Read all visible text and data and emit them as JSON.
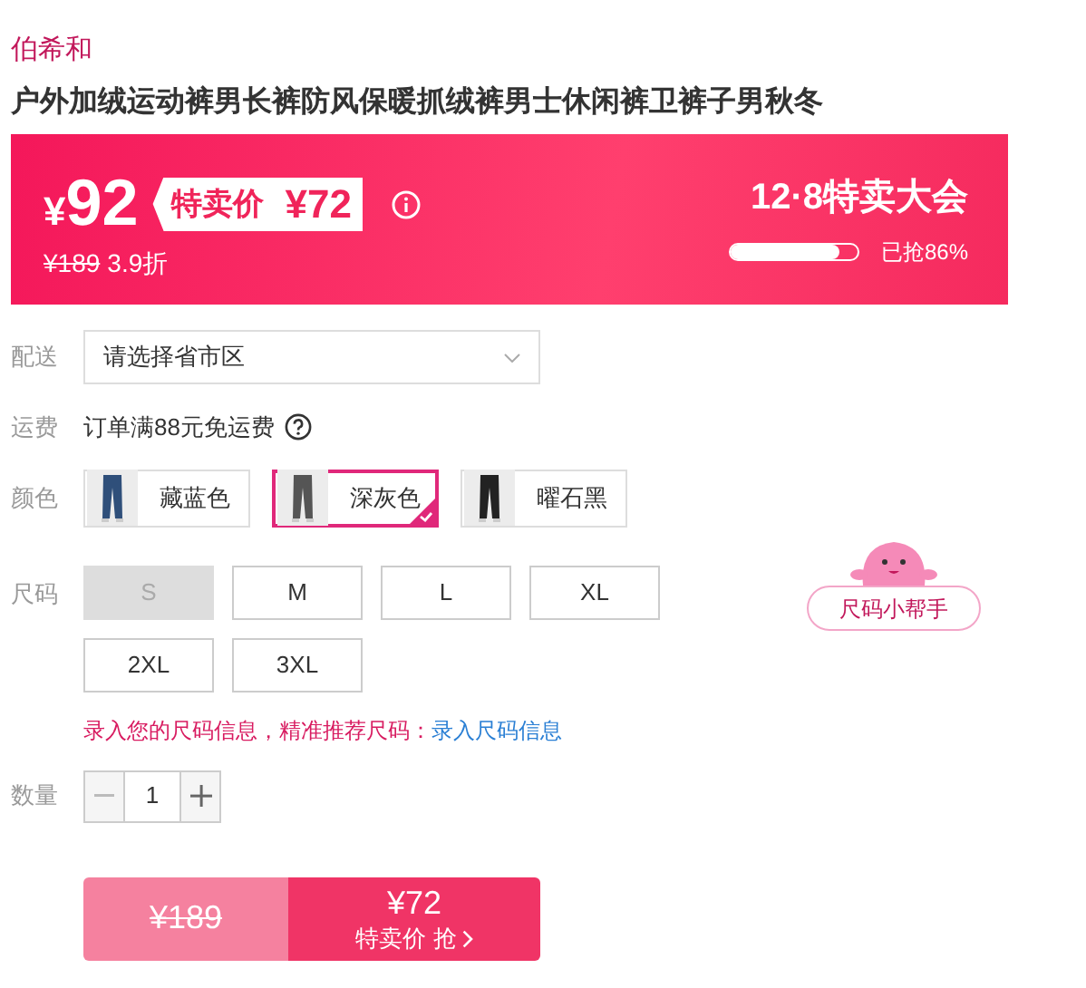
{
  "brand": "伯希和",
  "title": "户外加绒运动裤男长裤防风保暖抓绒裤男士休闲裤卫裤子男秋冬",
  "promo": {
    "currency": "¥",
    "price": "92",
    "tag_label": "特卖价",
    "tag_price": "¥72",
    "original_price": "¥189",
    "discount": "3.9折",
    "event": "12·8特卖大会",
    "level": 0.86,
    "sold": "已抢86%"
  },
  "delivery": {
    "label": "配送",
    "value": "请选择省市区"
  },
  "shipping": {
    "label": "运费",
    "text": "订单满88元免运费"
  },
  "colors": {
    "label": "颜色",
    "options": [
      {
        "name": "藏蓝色",
        "selected": false
      },
      {
        "name": "深灰色",
        "selected": true
      },
      {
        "name": "曜石黑",
        "selected": false
      }
    ]
  },
  "sizes": {
    "label": "尺码",
    "options": [
      {
        "name": "S",
        "disabled": true
      },
      {
        "name": "M",
        "disabled": false
      },
      {
        "name": "L",
        "disabled": false
      },
      {
        "name": "XL",
        "disabled": false
      },
      {
        "name": "2XL",
        "disabled": false
      },
      {
        "name": "3XL",
        "disabled": false
      }
    ]
  },
  "size_helper": "尺码小帮手",
  "size_hint": {
    "text": "录入您的尺码信息，精准推荐尺码：",
    "link": "录入尺码信息"
  },
  "quantity": {
    "label": "数量",
    "value": "1"
  },
  "buy": {
    "original_price": "¥189",
    "price": "¥72",
    "action": "特卖价 抢"
  }
}
